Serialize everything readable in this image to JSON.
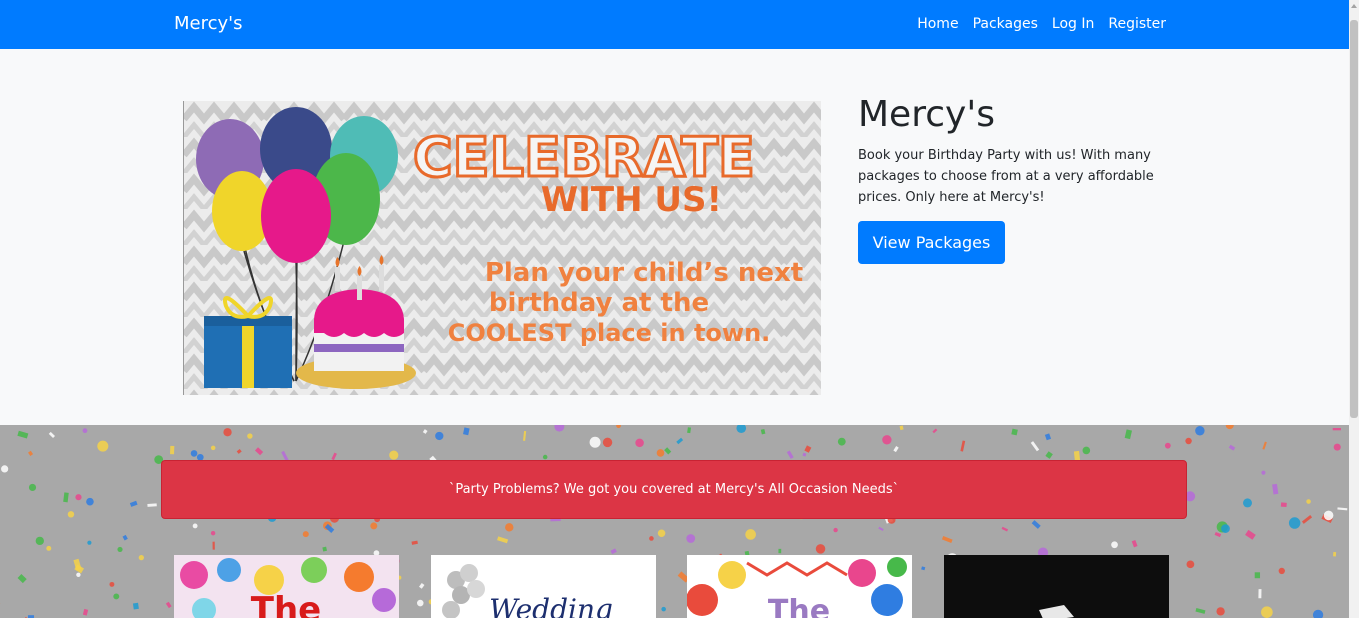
{
  "navbar": {
    "brand": "Mercy's",
    "links": [
      "Home",
      "Packages",
      "Log In",
      "Register"
    ]
  },
  "jumbotron": {
    "title": "Mercy's",
    "text": "Book your Birthday Party with us! With many packages to choose from at a very affordable prices. Only here at Mercy's!",
    "button_label": "View Packages"
  },
  "banner": {
    "headline1": "CELEBRATE",
    "headline2": "WITH US!",
    "line1": "Plan your child’s next",
    "line2": "birthday at the",
    "line3": "COOLEST place in town."
  },
  "alert": {
    "text": "`Party Problems? We got you covered at Mercy's All Occasion Needs`"
  },
  "thumbnails": [
    {
      "caption": "The"
    },
    {
      "caption": "Wedding"
    },
    {
      "caption": "The"
    },
    {
      "caption": ""
    }
  ],
  "colors": {
    "primary": "#007bff",
    "danger": "#dc3545",
    "banner_orange": "#e86a2b"
  }
}
